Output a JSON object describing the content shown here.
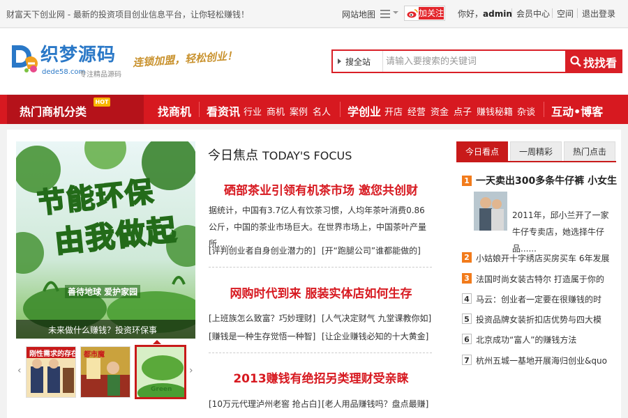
{
  "topbar": {
    "slogan": "财富天下创业网 - 最新的投资项目创业信息平台，让你轻松赚钱！",
    "sitemap": "网站地图",
    "follow": "加关注",
    "hello_prefix": "你好，",
    "username": "admin",
    "links": [
      "会员中心",
      "空间",
      "退出登录"
    ]
  },
  "header": {
    "logo_cn": "织梦源码",
    "logo_url": "dede58.com",
    "logo_sub": "专注精品源码",
    "tagline": "连锁加盟，轻松创业！",
    "search": {
      "scope": "搜全站",
      "placeholder": "请输入要搜索的关键词",
      "button": "找找看"
    }
  },
  "nav": {
    "category": "热门商机分类",
    "hot_badge": "HOT",
    "items": [
      {
        "label": "找商机",
        "size": "big"
      },
      {
        "label": "看资讯",
        "size": "big"
      },
      {
        "label": "行业",
        "size": "small"
      },
      {
        "label": "商机",
        "size": "small"
      },
      {
        "label": "案例",
        "size": "small"
      },
      {
        "label": "名人",
        "size": "small"
      },
      {
        "label": "学创业",
        "size": "big"
      },
      {
        "label": "开店",
        "size": "small"
      },
      {
        "label": "经营",
        "size": "small"
      },
      {
        "label": "资金",
        "size": "small"
      },
      {
        "label": "点子",
        "size": "small"
      },
      {
        "label": "赚钱秘籍",
        "size": "small"
      },
      {
        "label": "杂谈",
        "size": "small"
      },
      {
        "label": "互动•博客",
        "size": "big"
      }
    ]
  },
  "slider": {
    "big_line1": "节能环保",
    "big_line2": "由我做起",
    "slogan": "善待地球 爱护家园",
    "caption": "未来做什么赚钱？投资环保事",
    "thumbs": [
      {
        "text": "刚性需求的存在"
      },
      {
        "text": "都市魔"
      },
      {
        "text": "Green"
      }
    ]
  },
  "focus": {
    "heading_cn": "今日焦点",
    "heading_en": "TODAY'S FOCUS",
    "articles": [
      {
        "title": "硒部茶业引领有机茶市场 邀您共创财",
        "summary": "据统计，中国有3.7亿人有饮茶习惯，人均年茶叶消费0.86公斤，中国的茶业市场巨大。在世界市场上，中国茶叶产量所......",
        "links": [
          "[评判创业者自身创业潜力的]",
          "[开“跑腿公司”谁都能做的]"
        ]
      },
      {
        "title": "网购时代到来 服装实体店如何生存",
        "summary": "",
        "links": [
          "[上班族怎么致富？巧妙理财]",
          "[人气决定财气 九堂课教你如]",
          "[赚钱是一种生存觉悟一种智]",
          "[让企业赚钱必知的十大黄金]"
        ]
      },
      {
        "title": "2013赚钱有绝招另类理财受亲睐",
        "summary": "",
        "links": [
          "[10万元代理泸州老窖 抢占白]",
          "[老人用品赚钱吗？盘点最赚]"
        ]
      }
    ]
  },
  "rank": {
    "tabs": [
      "今日看点",
      "一周精彩",
      "热门点击"
    ],
    "first_title": "一天卖出300多条牛仔裤 小女生",
    "first_intro": "2011年，邱小兰开了一家牛仔专卖店，她选择牛仔品......",
    "items": [
      {
        "num": "1",
        "title": "一天卖出300多条牛仔裤 小女生"
      },
      {
        "num": "2",
        "title": "小姑娘开十字绣店买房买车 6年发展"
      },
      {
        "num": "3",
        "title": "法国时尚女装古特尔 打造属于你的"
      },
      {
        "num": "4",
        "title": "马云：创业者一定要在很赚钱的时"
      },
      {
        "num": "5",
        "title": "投资品牌女装折扣店优势与四大模"
      },
      {
        "num": "6",
        "title": "北京成功“富人”的赚钱方法"
      },
      {
        "num": "7",
        "title": "杭州五城一基地开展海归创业&quo"
      }
    ]
  },
  "colors": {
    "brand_red": "#d71920",
    "nav_dark_red": "#b5121a",
    "logo_blue": "#2a78c7",
    "rank_orange": "#f27b1b"
  }
}
